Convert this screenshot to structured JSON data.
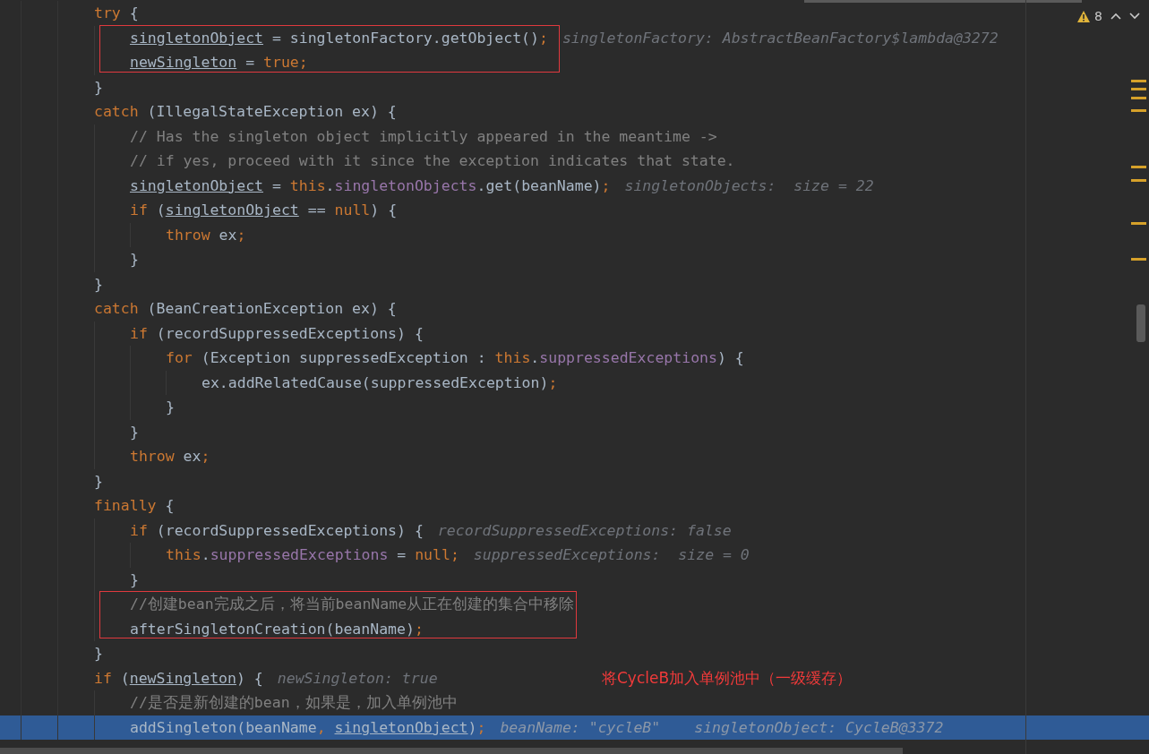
{
  "inspections": {
    "count": "8"
  },
  "lines": [
    {
      "kind": "line",
      "code": [
        {
          "text": "try",
          "kind": "keyword"
        },
        {
          "text": " {",
          "kind": "plain"
        }
      ],
      "children": [
        {
          "kind": "box",
          "lines": [
            {
              "kind": "line",
              "code": [
                {
                  "text": "singletonObject",
                  "kind": "variable"
                },
                {
                  "text": " = singletonFactory.getObject()",
                  "kind": "plain"
                },
                {
                  "text": ";",
                  "kind": "keyword"
                }
              ],
              "hints": [
                "singletonFactory: AbstractBeanFactory$lambda@3272"
              ]
            },
            {
              "kind": "line",
              "code": [
                {
                  "text": "newSingleton",
                  "kind": "variable"
                },
                {
                  "text": " = ",
                  "kind": "plain"
                },
                {
                  "text": "true;",
                  "kind": "keyword"
                }
              ]
            }
          ]
        }
      ]
    },
    {
      "kind": "line",
      "code": [
        {
          "text": "}",
          "kind": "plain"
        }
      ]
    },
    {
      "kind": "line",
      "code": [
        {
          "text": "catch",
          "kind": "keyword"
        },
        {
          "text": " (IllegalStateException ex) {",
          "kind": "plain"
        }
      ],
      "children": [
        {
          "kind": "line",
          "code": [
            {
              "text": "// Has the singleton object implicitly appeared in the meantime ->",
              "kind": "comment"
            }
          ]
        },
        {
          "kind": "line",
          "code": [
            {
              "text": "// if yes, proceed with it since the exception indicates that state.",
              "kind": "comment"
            }
          ]
        },
        {
          "kind": "line",
          "code": [
            {
              "text": "singletonObject",
              "kind": "variable"
            },
            {
              "text": " = ",
              "kind": "plain"
            },
            {
              "text": "this",
              "kind": "keyword"
            },
            {
              "text": ".",
              "kind": "plain"
            },
            {
              "text": "singletonObjects",
              "kind": "field"
            },
            {
              "text": ".get(beanName)",
              "kind": "plain"
            },
            {
              "text": ";",
              "kind": "keyword"
            }
          ],
          "hints": [
            "singletonObjects:  size = 22"
          ]
        },
        {
          "kind": "line",
          "code": [
            {
              "text": "if",
              "kind": "keyword"
            },
            {
              "text": " (",
              "kind": "plain"
            },
            {
              "text": "singletonObject",
              "kind": "variable"
            },
            {
              "text": " == ",
              "kind": "plain"
            },
            {
              "text": "null",
              "kind": "keyword"
            },
            {
              "text": ") {",
              "kind": "plain"
            }
          ],
          "children": [
            {
              "kind": "line",
              "code": [
                {
                  "text": "throw",
                  "kind": "keyword"
                },
                {
                  "text": " ex",
                  "kind": "plain"
                },
                {
                  "text": ";",
                  "kind": "keyword"
                }
              ]
            }
          ]
        },
        {
          "kind": "line",
          "code": [
            {
              "text": "}",
              "kind": "plain"
            }
          ]
        }
      ]
    },
    {
      "kind": "line",
      "code": [
        {
          "text": "}",
          "kind": "plain"
        }
      ]
    },
    {
      "kind": "line",
      "code": [
        {
          "text": "catch",
          "kind": "keyword"
        },
        {
          "text": " (BeanCreationException ex) {",
          "kind": "plain"
        }
      ],
      "children": [
        {
          "kind": "line",
          "code": [
            {
              "text": "if",
              "kind": "keyword"
            },
            {
              "text": " (recordSuppressedExceptions) {",
              "kind": "plain"
            }
          ],
          "children": [
            {
              "kind": "line",
              "code": [
                {
                  "text": "for",
                  "kind": "keyword"
                },
                {
                  "text": " (Exception suppressedException : ",
                  "kind": "plain"
                },
                {
                  "text": "this",
                  "kind": "keyword"
                },
                {
                  "text": ".",
                  "kind": "plain"
                },
                {
                  "text": "suppressedExceptions",
                  "kind": "field"
                },
                {
                  "text": ") {",
                  "kind": "plain"
                }
              ],
              "children": [
                {
                  "kind": "line",
                  "code": [
                    {
                      "text": "ex.addRelatedCause(suppressedException)",
                      "kind": "plain"
                    },
                    {
                      "text": ";",
                      "kind": "keyword"
                    }
                  ]
                }
              ]
            },
            {
              "kind": "line",
              "code": [
                {
                  "text": "}",
                  "kind": "plain"
                }
              ]
            }
          ]
        },
        {
          "kind": "line",
          "code": [
            {
              "text": "}",
              "kind": "plain"
            }
          ]
        },
        {
          "kind": "line",
          "code": [
            {
              "text": "throw",
              "kind": "keyword"
            },
            {
              "text": " ex",
              "kind": "plain"
            },
            {
              "text": ";",
              "kind": "keyword"
            }
          ]
        }
      ]
    },
    {
      "kind": "line",
      "code": [
        {
          "text": "}",
          "kind": "plain"
        }
      ]
    },
    {
      "kind": "line",
      "code": [
        {
          "text": "finally",
          "kind": "keyword"
        },
        {
          "text": " {",
          "kind": "plain"
        }
      ],
      "children": [
        {
          "kind": "line",
          "code": [
            {
              "text": "if",
              "kind": "keyword"
            },
            {
              "text": " (recordSuppressedExceptions) {",
              "kind": "plain"
            }
          ],
          "hints": [
            "recordSuppressedExceptions: false"
          ],
          "children": [
            {
              "kind": "line",
              "code": [
                {
                  "text": "this",
                  "kind": "keyword"
                },
                {
                  "text": ".",
                  "kind": "plain"
                },
                {
                  "text": "suppressedExceptions",
                  "kind": "field"
                },
                {
                  "text": " = ",
                  "kind": "plain"
                },
                {
                  "text": "null;",
                  "kind": "keyword"
                }
              ],
              "hints": [
                "suppressedExceptions:  size = 0"
              ]
            }
          ]
        },
        {
          "kind": "line",
          "code": [
            {
              "text": "}",
              "kind": "plain"
            }
          ]
        },
        {
          "kind": "box",
          "lines": [
            {
              "kind": "line",
              "code": [
                {
                  "text": "//创建bean完成之后，将当前beanName从正在创建的集合中移除",
                  "kind": "comment"
                }
              ]
            },
            {
              "kind": "line",
              "code": [
                {
                  "text": "afterSingletonCreation(beanName)",
                  "kind": "plain"
                },
                {
                  "text": ";",
                  "kind": "keyword"
                }
              ]
            }
          ]
        }
      ]
    },
    {
      "kind": "line",
      "code": [
        {
          "text": "}",
          "kind": "plain"
        }
      ]
    },
    {
      "kind": "line",
      "code": [
        {
          "text": "if",
          "kind": "keyword"
        },
        {
          "text": " (",
          "kind": "plain"
        },
        {
          "text": "newSingleton",
          "kind": "variable"
        },
        {
          "text": ") {",
          "kind": "plain"
        }
      ],
      "hints": [
        "newSingleton: true"
      ],
      "note": "将CycleB加入单例池中（一级缓存）",
      "children": [
        {
          "kind": "line",
          "code": [
            {
              "text": "//是否是新创建的bean，如果是，加入单例池中",
              "kind": "comment"
            }
          ]
        },
        {
          "kind": "line",
          "current": true,
          "code": [
            {
              "text": "addSingleton(beanName",
              "kind": "plain"
            },
            {
              "text": ", ",
              "kind": "keyword"
            },
            {
              "text": "singletonObject",
              "kind": "variable"
            },
            {
              "text": ")",
              "kind": "plain"
            },
            {
              "text": ";",
              "kind": "keyword"
            }
          ],
          "hints": [
            "beanName: \"cycleB\"",
            "singletonObject: CycleB@3372"
          ]
        }
      ]
    }
  ]
}
